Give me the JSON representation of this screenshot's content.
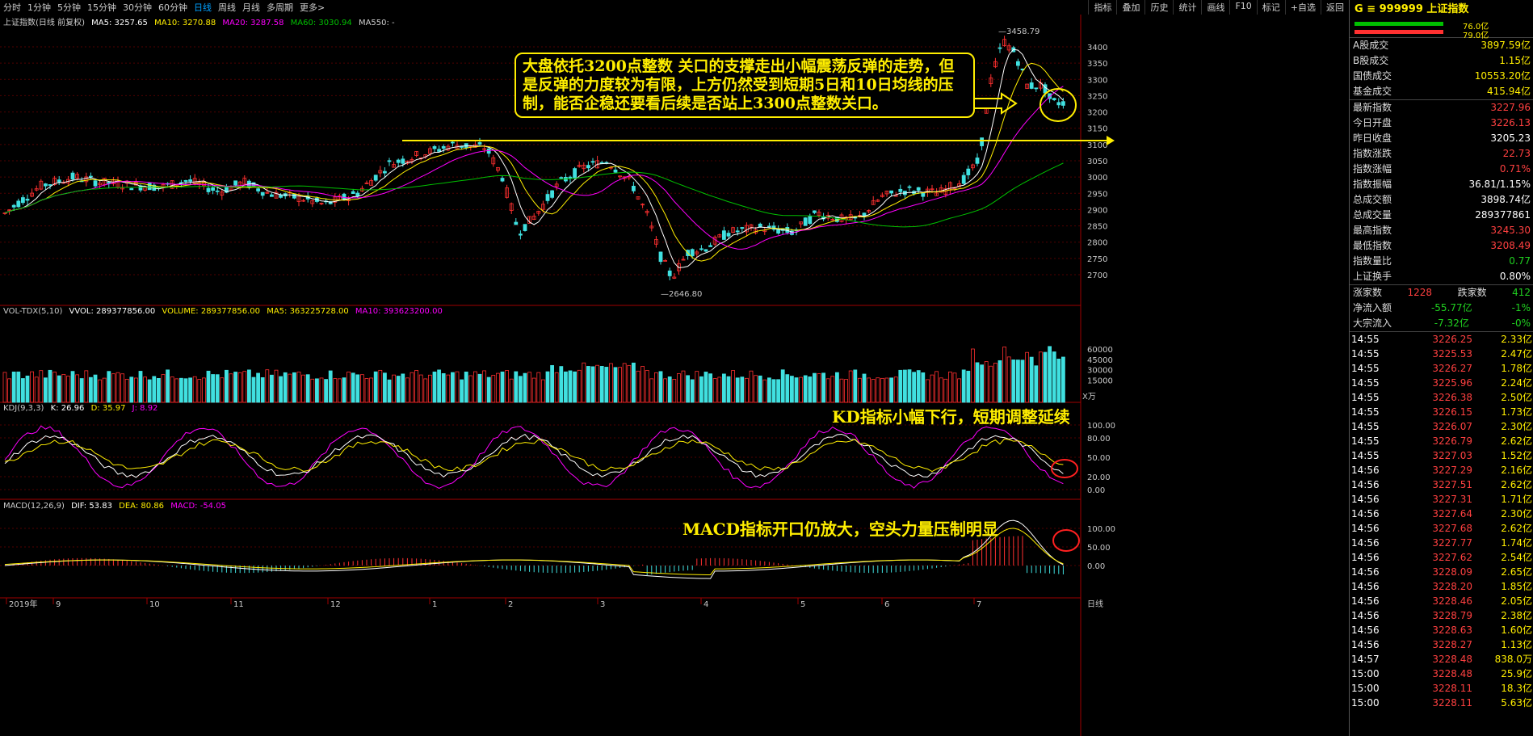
{
  "toolbar": {
    "timeframes": [
      "分时",
      "1分钟",
      "5分钟",
      "15分钟",
      "30分钟",
      "60分钟",
      "日线",
      "周线",
      "月线",
      "多周期",
      "更多>"
    ],
    "active": "日线",
    "right_tools": [
      "指标",
      "叠加",
      "历史",
      "统计",
      "画线",
      "F10",
      "标记",
      "+自选",
      "返回"
    ]
  },
  "main_legend": {
    "title": "上证指数(日线 前复权)",
    "ma5": "MA5: 3257.65",
    "ma10": "MA10: 3270.88",
    "ma20": "MA20: 3287.58",
    "ma60": "MA60: 3030.94",
    "ma550": "MA550: -"
  },
  "price_axis": [
    "3400",
    "3350",
    "3300",
    "3250",
    "3200",
    "3150",
    "3100",
    "3050",
    "3000",
    "2950",
    "2900",
    "2850",
    "2800",
    "2750",
    "2700"
  ],
  "high_label": "3458.79",
  "low_label": "2646.80",
  "vol_legend": {
    "title": "VOL-TDX(5,10)",
    "vvol": "VVOL: 289377856.00",
    "volume": "VOLUME: 289377856.00",
    "ma5": "MA5: 363225728.00",
    "ma10": "MA10: 393623200.00"
  },
  "vol_axis": [
    "60000",
    "45000",
    "30000",
    "15000"
  ],
  "vol_unit": "X万",
  "kdj_legend": {
    "title": "KDJ(9,3,3)",
    "k": "K: 26.96",
    "d": "D: 35.97",
    "j": "J: 8.92"
  },
  "kdj_axis": [
    "100.00",
    "80.00",
    "50.00",
    "20.00",
    "0.00"
  ],
  "macd_legend": {
    "title": "MACD(12,26,9)",
    "dif": "DIF: 53.83",
    "dea": "DEA: 80.86",
    "macd": "MACD: -54.05"
  },
  "macd_axis": [
    "100.00",
    "50.00",
    "0.00"
  ],
  "date_axis": [
    "2019年",
    "9",
    "10",
    "11",
    "12",
    "1",
    "2",
    "3",
    "4",
    "5",
    "6",
    "7"
  ],
  "date_mode": "日线",
  "annotations": {
    "main": "大盘依托3200点整数 关口的支撑走出小幅震荡反弹的走势，但是反弹的力度较为有限，上方仍然受到短期5日和10日均线的压制，能否企稳还要看后续是否站上3300点整数关口。",
    "kdj": "KD指标小幅下行，短期调整延续",
    "macd": "MACD指标开口仍放大，空头力量压制明显"
  },
  "right_panel": {
    "header": "G ≡ 999999 上证指数",
    "bar_values": [
      "76.0亿",
      "79.0亿"
    ],
    "stats": [
      [
        "A股成交",
        "3897.59亿"
      ],
      [
        "B股成交",
        "1.15亿"
      ],
      [
        "国债成交",
        "10553.20亿"
      ],
      [
        "基金成交",
        "415.94亿"
      ]
    ],
    "index_stats": [
      [
        "最新指数",
        "3227.96"
      ],
      [
        "今日开盘",
        "3226.13"
      ],
      [
        "昨日收盘",
        "3205.23"
      ],
      [
        "指数涨跌",
        "22.73"
      ],
      [
        "指数涨幅",
        "0.71%"
      ],
      [
        "指数振幅",
        "36.81/1.15%"
      ],
      [
        "总成交额",
        "3898.74亿"
      ],
      [
        "总成交量",
        "289377861"
      ],
      [
        "最高指数",
        "3245.30"
      ],
      [
        "最低指数",
        "3208.49"
      ],
      [
        "指数量比",
        "0.77"
      ],
      [
        "上证换手",
        "0.80%"
      ]
    ],
    "breadth": {
      "up_label": "涨家数",
      "up": "1228",
      "down_label": "跌家数",
      "down": "412"
    },
    "flows": [
      [
        "净流入额",
        "-55.77亿",
        "-1%"
      ],
      [
        "大宗流入",
        "-7.32亿",
        "-0%"
      ]
    ],
    "ticks": [
      [
        "14:55",
        "3226.25",
        "2.33亿"
      ],
      [
        "14:55",
        "3225.53",
        "2.47亿"
      ],
      [
        "14:55",
        "3226.27",
        "1.78亿"
      ],
      [
        "14:55",
        "3225.96",
        "2.24亿"
      ],
      [
        "14:55",
        "3226.38",
        "2.50亿"
      ],
      [
        "14:55",
        "3226.15",
        "1.73亿"
      ],
      [
        "14:55",
        "3226.07",
        "2.30亿"
      ],
      [
        "14:55",
        "3226.79",
        "2.62亿"
      ],
      [
        "14:55",
        "3227.03",
        "1.52亿"
      ],
      [
        "14:56",
        "3227.29",
        "2.16亿"
      ],
      [
        "14:56",
        "3227.51",
        "2.62亿"
      ],
      [
        "14:56",
        "3227.31",
        "1.71亿"
      ],
      [
        "14:56",
        "3227.64",
        "2.30亿"
      ],
      [
        "14:56",
        "3227.68",
        "2.62亿"
      ],
      [
        "14:56",
        "3227.77",
        "1.74亿"
      ],
      [
        "14:56",
        "3227.62",
        "2.54亿"
      ],
      [
        "14:56",
        "3228.09",
        "2.65亿"
      ],
      [
        "14:56",
        "3228.20",
        "1.85亿"
      ],
      [
        "14:56",
        "3228.46",
        "2.05亿"
      ],
      [
        "14:56",
        "3228.79",
        "2.38亿"
      ],
      [
        "14:56",
        "3228.63",
        "1.60亿"
      ],
      [
        "14:56",
        "3228.27",
        "1.13亿"
      ],
      [
        "14:57",
        "3228.48",
        "838.0万"
      ],
      [
        "15:00",
        "3228.48",
        "25.9亿"
      ],
      [
        "15:00",
        "3228.11",
        "18.3亿"
      ],
      [
        "15:00",
        "3228.11",
        "5.63亿"
      ]
    ]
  },
  "colors": {
    "up": "#ff3030",
    "down": "#40e0e0",
    "ma5": "#ffffff",
    "ma10": "#ffee00",
    "ma20": "#ff00ff",
    "ma60": "#00c000",
    "annotation": "#ffee00"
  }
}
